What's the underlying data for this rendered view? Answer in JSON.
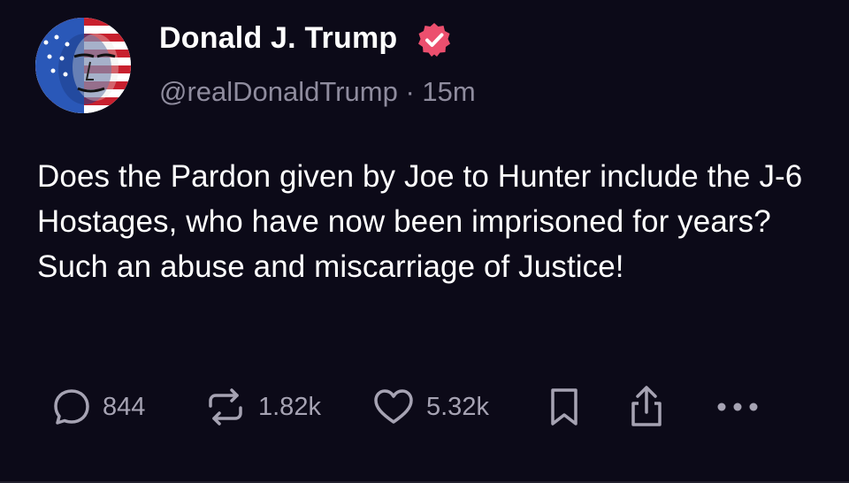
{
  "post": {
    "author_name": "Donald J. Trump",
    "handle": "@realDonaldTrump",
    "separator": "·",
    "time_ago": "15m",
    "text": "Does the Pardon given by Joe to Hunter include the J-6 Hostages, who have now been imprisoned for years? Such an abuse and miscarriage of Justice!"
  },
  "actions": {
    "replies": "844",
    "reposts": "1.82k",
    "likes": "5.32k"
  },
  "icons": {
    "verified": "verified-badge-icon",
    "reply": "comment-bubble-icon",
    "repost": "repost-arrows-icon",
    "like": "heart-icon",
    "bookmark": "bookmark-icon",
    "share": "share-upload-icon",
    "more": "more-dots-icon"
  },
  "colors": {
    "background": "#0c0a18",
    "verified_badge": "#ec4f6e",
    "muted_text": "#8f8c9e",
    "icon": "#a6a3b3"
  }
}
